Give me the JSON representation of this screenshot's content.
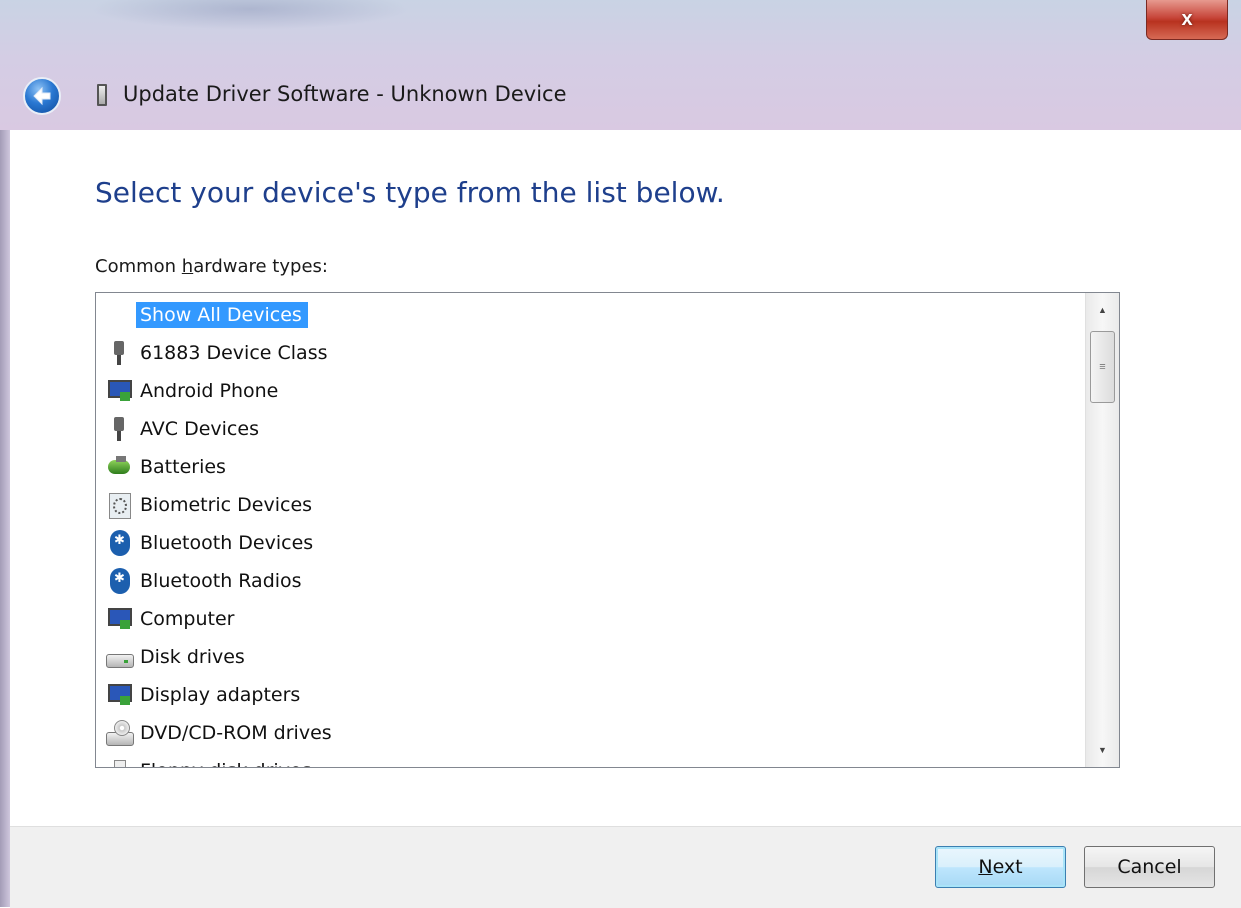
{
  "window": {
    "title": "Update Driver Software - Unknown Device",
    "close_label": "x"
  },
  "main": {
    "heading": "Select your device's type from the list below.",
    "list_label_pre": "Common ",
    "list_label_accel": "h",
    "list_label_post": "ardware types:",
    "items": [
      {
        "label": "Show All Devices",
        "icon": "none",
        "selected": true
      },
      {
        "label": "61883 Device Class",
        "icon": "usb-plug-icon"
      },
      {
        "label": "Android Phone",
        "icon": "monitor-icon"
      },
      {
        "label": "AVC Devices",
        "icon": "usb-plug-icon"
      },
      {
        "label": "Batteries",
        "icon": "battery-icon"
      },
      {
        "label": "Biometric Devices",
        "icon": "fingerprint-icon"
      },
      {
        "label": "Bluetooth Devices",
        "icon": "bluetooth-icon"
      },
      {
        "label": "Bluetooth Radios",
        "icon": "bluetooth-icon"
      },
      {
        "label": "Computer",
        "icon": "computer-icon"
      },
      {
        "label": "Disk drives",
        "icon": "disk-drive-icon"
      },
      {
        "label": "Display adapters",
        "icon": "monitor-icon"
      },
      {
        "label": "DVD/CD-ROM drives",
        "icon": "dvd-drive-icon"
      },
      {
        "label": "Floppy disk drives",
        "icon": "floppy-icon"
      }
    ]
  },
  "footer": {
    "next_accel": "N",
    "next_rest": "ext",
    "cancel_label": "Cancel"
  },
  "colors": {
    "heading": "#1e3f8c",
    "selection": "#3399ff",
    "selection_text": "#ffffff"
  }
}
